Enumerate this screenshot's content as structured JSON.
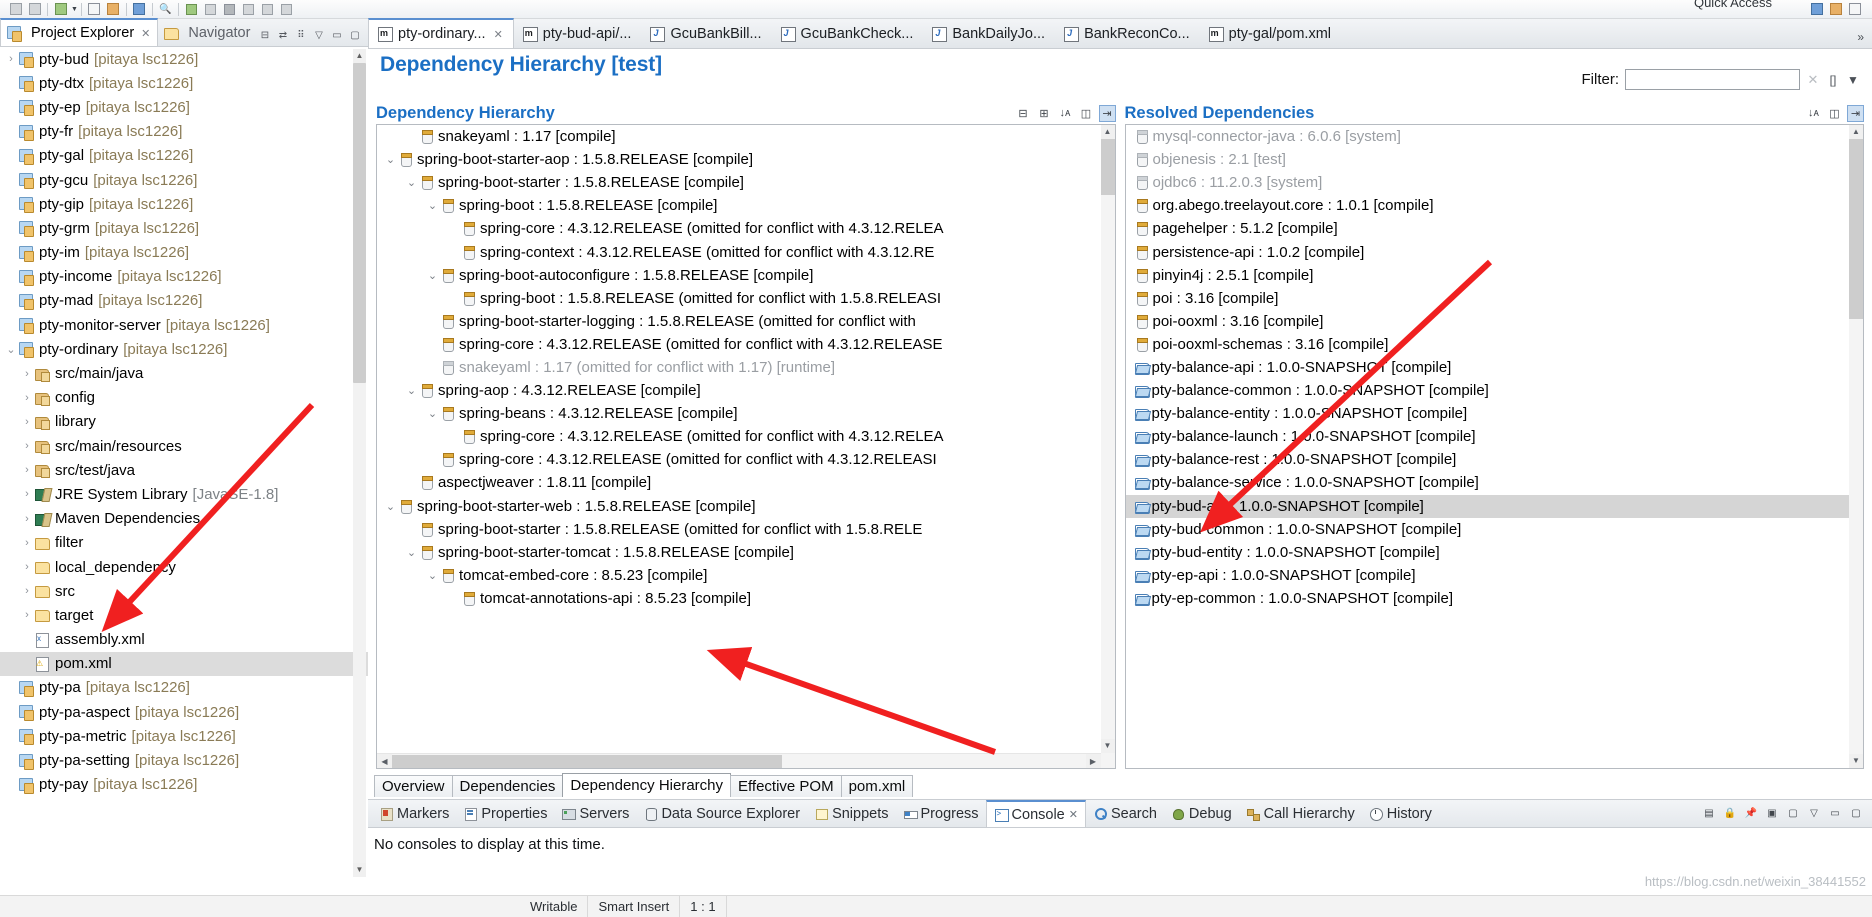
{
  "window": {
    "quick_access": "Quick Access"
  },
  "toolbar": {
    "icons": [
      "save-icon",
      "save-all-icon",
      "export-icon",
      "run-icon",
      "debug-icon",
      "terminal-icon",
      "search-icon",
      "step-over-icon",
      "pause-icon",
      "stop-icon",
      "profile-icon",
      "perspective-icon"
    ]
  },
  "project_explorer": {
    "tabs": [
      {
        "label": "Project Explorer",
        "icon": "project-explorer-icon",
        "active": true,
        "closable": true
      },
      {
        "label": "Navigator",
        "icon": "navigator-icon",
        "active": false,
        "closable": false
      }
    ],
    "toolbar_icons": [
      "collapse-all-icon",
      "link-with-editor-icon",
      "view-menu-icon",
      "minimize-icon",
      "maximize-icon"
    ],
    "tree": [
      {
        "indent": 0,
        "twisty": ">",
        "icon": "maven-project-icon",
        "label": "pty-bud",
        "suffix": "[pitaya lsc1226]",
        "selected": false
      },
      {
        "indent": 0,
        "twisty": "",
        "icon": "maven-project-icon",
        "label": "pty-dtx",
        "suffix": "[pitaya lsc1226]",
        "selected": false
      },
      {
        "indent": 0,
        "twisty": "",
        "icon": "maven-project-icon",
        "label": "pty-ep",
        "suffix": "[pitaya lsc1226]",
        "selected": false
      },
      {
        "indent": 0,
        "twisty": "",
        "icon": "maven-project-icon",
        "label": "pty-fr",
        "suffix": "[pitaya lsc1226]",
        "selected": false
      },
      {
        "indent": 0,
        "twisty": "",
        "icon": "maven-project-icon",
        "label": "pty-gal",
        "suffix": "[pitaya lsc1226]",
        "selected": false
      },
      {
        "indent": 0,
        "twisty": "",
        "icon": "maven-project-icon",
        "label": "pty-gcu",
        "suffix": "[pitaya lsc1226]",
        "selected": false
      },
      {
        "indent": 0,
        "twisty": "",
        "icon": "maven-project-icon",
        "label": "pty-gip",
        "suffix": "[pitaya lsc1226]",
        "selected": false
      },
      {
        "indent": 0,
        "twisty": "",
        "icon": "maven-project-icon",
        "label": "pty-grm",
        "suffix": "[pitaya lsc1226]",
        "selected": false
      },
      {
        "indent": 0,
        "twisty": "",
        "icon": "maven-project-icon",
        "label": "pty-im",
        "suffix": "[pitaya lsc1226]",
        "selected": false
      },
      {
        "indent": 0,
        "twisty": "",
        "icon": "maven-project-icon",
        "label": "pty-income",
        "suffix": "[pitaya lsc1226]",
        "selected": false
      },
      {
        "indent": 0,
        "twisty": "",
        "icon": "maven-project-icon",
        "label": "pty-mad",
        "suffix": "[pitaya lsc1226]",
        "selected": false
      },
      {
        "indent": 0,
        "twisty": "",
        "icon": "maven-project-icon",
        "label": "pty-monitor-server",
        "suffix": "[pitaya lsc1226]",
        "selected": false
      },
      {
        "indent": 0,
        "twisty": "v",
        "icon": "maven-project-icon",
        "label": "pty-ordinary",
        "suffix": "[pitaya lsc1226]",
        "selected": false
      },
      {
        "indent": 1,
        "twisty": ">",
        "icon": "source-folder-icon",
        "label": "src/main/java",
        "suffix": "",
        "selected": false
      },
      {
        "indent": 1,
        "twisty": ">",
        "icon": "source-folder-icon",
        "label": "config",
        "suffix": "",
        "selected": false
      },
      {
        "indent": 1,
        "twisty": ">",
        "icon": "source-folder-icon",
        "label": "library",
        "suffix": "",
        "selected": false
      },
      {
        "indent": 1,
        "twisty": ">",
        "icon": "source-folder-icon",
        "label": "src/main/resources",
        "suffix": "",
        "selected": false
      },
      {
        "indent": 1,
        "twisty": ">",
        "icon": "source-folder-icon",
        "label": "src/test/java",
        "suffix": "",
        "selected": false
      },
      {
        "indent": 1,
        "twisty": ">",
        "icon": "library-icon",
        "label": "JRE System Library",
        "suffix": "[JavaSE-1.8]",
        "selected": false
      },
      {
        "indent": 1,
        "twisty": ">",
        "icon": "library-icon",
        "label": "Maven Dependencies",
        "suffix": "",
        "selected": false
      },
      {
        "indent": 1,
        "twisty": ">",
        "icon": "folder-icon",
        "label": "filter",
        "suffix": "",
        "selected": false
      },
      {
        "indent": 1,
        "twisty": ">",
        "icon": "folder-icon",
        "label": "local_dependency",
        "suffix": "",
        "selected": false
      },
      {
        "indent": 1,
        "twisty": ">",
        "icon": "folder-icon",
        "label": "src",
        "suffix": "",
        "selected": false
      },
      {
        "indent": 1,
        "twisty": ">",
        "icon": "folder-icon",
        "label": "target",
        "suffix": "",
        "selected": false
      },
      {
        "indent": 1,
        "twisty": "",
        "icon": "xml-file-icon",
        "label": "assembly.xml",
        "suffix": "",
        "selected": false
      },
      {
        "indent": 1,
        "twisty": "",
        "icon": "xml-warning-file-icon",
        "label": "pom.xml",
        "suffix": "",
        "selected": true
      },
      {
        "indent": 0,
        "twisty": "",
        "icon": "maven-project-icon",
        "label": "pty-pa",
        "suffix": "[pitaya lsc1226]",
        "selected": false
      },
      {
        "indent": 0,
        "twisty": "",
        "icon": "maven-project-icon",
        "label": "pty-pa-aspect",
        "suffix": "[pitaya lsc1226]",
        "selected": false
      },
      {
        "indent": 0,
        "twisty": "",
        "icon": "maven-project-icon",
        "label": "pty-pa-metric",
        "suffix": "[pitaya lsc1226]",
        "selected": false
      },
      {
        "indent": 0,
        "twisty": "",
        "icon": "maven-project-icon",
        "label": "pty-pa-setting",
        "suffix": "[pitaya lsc1226]",
        "selected": false
      },
      {
        "indent": 0,
        "twisty": "",
        "icon": "maven-project-icon",
        "label": "pty-pay",
        "suffix": "[pitaya lsc1226]",
        "selected": false
      }
    ]
  },
  "editor": {
    "tabs": [
      {
        "label": "pty-ordinary...",
        "icon": "maven-pom-icon",
        "active": true,
        "closable": true
      },
      {
        "label": "pty-bud-api/...",
        "icon": "maven-pom-icon",
        "active": false,
        "closable": false
      },
      {
        "label": "GcuBankBill...",
        "icon": "java-file-icon",
        "active": false,
        "closable": false
      },
      {
        "label": "GcuBankCheck...",
        "icon": "java-file-icon",
        "active": false,
        "closable": false
      },
      {
        "label": "BankDailyJo...",
        "icon": "java-file-icon",
        "active": false,
        "closable": false
      },
      {
        "label": "BankReconCo...",
        "icon": "java-file-icon",
        "active": false,
        "closable": false
      },
      {
        "label": "pty-gal/pom.xml",
        "icon": "maven-pom-icon",
        "active": false,
        "closable": false
      }
    ],
    "overflow_label": "»",
    "title": "Dependency Hierarchy [test]",
    "filter": {
      "label": "Filter:",
      "value": "",
      "placeholder": "",
      "clear_icon": "clear-filter-icon",
      "expand_icon": "expand-icon",
      "menu_icon": "filter-menu-icon"
    },
    "form_tabs": [
      {
        "label": "Overview",
        "active": false
      },
      {
        "label": "Dependencies",
        "active": false
      },
      {
        "label": "Dependency Hierarchy",
        "active": true
      },
      {
        "label": "Effective POM",
        "active": false
      },
      {
        "label": "pom.xml",
        "active": false
      }
    ]
  },
  "hierarchy_pane": {
    "title": "Dependency Hierarchy",
    "tools": [
      "collapse-all-icon",
      "expand-all-icon",
      "sort-alphabetically-icon",
      "show-groupid-icon",
      "link-selection-icon"
    ],
    "rows": [
      {
        "indent": 1,
        "twisty": "",
        "label": "snakeyaml : 1.17 [compile]",
        "dim": false,
        "selected": false
      },
      {
        "indent": 0,
        "twisty": "v",
        "label": "spring-boot-starter-aop : 1.5.8.RELEASE [compile]",
        "dim": false,
        "selected": false
      },
      {
        "indent": 1,
        "twisty": "v",
        "label": "spring-boot-starter : 1.5.8.RELEASE [compile]",
        "dim": false,
        "selected": false
      },
      {
        "indent": 2,
        "twisty": "v",
        "label": "spring-boot : 1.5.8.RELEASE [compile]",
        "dim": false,
        "selected": false
      },
      {
        "indent": 3,
        "twisty": "",
        "label": "spring-core : 4.3.12.RELEASE (omitted for conflict with 4.3.12.RELEA",
        "dim": false,
        "selected": false
      },
      {
        "indent": 3,
        "twisty": "",
        "label": "spring-context : 4.3.12.RELEASE (omitted for conflict with 4.3.12.RE",
        "dim": false,
        "selected": false
      },
      {
        "indent": 2,
        "twisty": "v",
        "label": "spring-boot-autoconfigure : 1.5.8.RELEASE [compile]",
        "dim": false,
        "selected": false
      },
      {
        "indent": 3,
        "twisty": "",
        "label": "spring-boot : 1.5.8.RELEASE (omitted for conflict with 1.5.8.RELEASI",
        "dim": false,
        "selected": false
      },
      {
        "indent": 2,
        "twisty": "",
        "label": "spring-boot-starter-logging : 1.5.8.RELEASE (omitted for conflict with",
        "dim": false,
        "selected": false
      },
      {
        "indent": 2,
        "twisty": "",
        "label": "spring-core : 4.3.12.RELEASE (omitted for conflict with 4.3.12.RELEASE",
        "dim": false,
        "selected": false
      },
      {
        "indent": 2,
        "twisty": "",
        "label": "snakeyaml : 1.17 (omitted for conflict with 1.17) [runtime]",
        "dim": true,
        "selected": false
      },
      {
        "indent": 1,
        "twisty": "v",
        "label": "spring-aop : 4.3.12.RELEASE [compile]",
        "dim": false,
        "selected": false
      },
      {
        "indent": 2,
        "twisty": "v",
        "label": "spring-beans : 4.3.12.RELEASE [compile]",
        "dim": false,
        "selected": false
      },
      {
        "indent": 3,
        "twisty": "",
        "label": "spring-core : 4.3.12.RELEASE (omitted for conflict with 4.3.12.RELEA",
        "dim": false,
        "selected": false
      },
      {
        "indent": 2,
        "twisty": "",
        "label": "spring-core : 4.3.12.RELEASE (omitted for conflict with 4.3.12.RELEASI",
        "dim": false,
        "selected": false
      },
      {
        "indent": 1,
        "twisty": "",
        "label": "aspectjweaver : 1.8.11 [compile]",
        "dim": false,
        "selected": false
      },
      {
        "indent": 0,
        "twisty": "v",
        "label": "spring-boot-starter-web : 1.5.8.RELEASE [compile]",
        "dim": false,
        "selected": false
      },
      {
        "indent": 1,
        "twisty": "",
        "label": "spring-boot-starter : 1.5.8.RELEASE (omitted for conflict with 1.5.8.RELE",
        "dim": false,
        "selected": false
      },
      {
        "indent": 1,
        "twisty": "v",
        "label": "spring-boot-starter-tomcat : 1.5.8.RELEASE [compile]",
        "dim": false,
        "selected": false
      },
      {
        "indent": 2,
        "twisty": "v",
        "label": "tomcat-embed-core : 8.5.23 [compile]",
        "dim": false,
        "selected": false
      },
      {
        "indent": 3,
        "twisty": "",
        "label": "tomcat-annotations-api : 8.5.23 [compile]",
        "dim": false,
        "selected": false
      }
    ]
  },
  "resolved_pane": {
    "title": "Resolved Dependencies",
    "tools": [
      "sort-icon",
      "show-groupid-icon",
      "link-selection-icon"
    ],
    "rows": [
      {
        "icon": "jar-icon",
        "label": "mysql-connector-java : 6.0.6 [system]",
        "dim": true,
        "selected": false
      },
      {
        "icon": "jar-icon",
        "label": "objenesis : 2.1 [test]",
        "dim": true,
        "selected": false
      },
      {
        "icon": "jar-icon",
        "label": "ojdbc6 : 11.2.0.3 [system]",
        "dim": true,
        "selected": false
      },
      {
        "icon": "jar-icon",
        "label": "org.abego.treelayout.core : 1.0.1 [compile]",
        "dim": false,
        "selected": false
      },
      {
        "icon": "jar-icon",
        "label": "pagehelper : 5.1.2 [compile]",
        "dim": false,
        "selected": false
      },
      {
        "icon": "jar-icon",
        "label": "persistence-api : 1.0.2 [compile]",
        "dim": false,
        "selected": false
      },
      {
        "icon": "jar-icon",
        "label": "pinyin4j : 2.5.1 [compile]",
        "dim": false,
        "selected": false
      },
      {
        "icon": "jar-icon",
        "label": "poi : 3.16 [compile]",
        "dim": false,
        "selected": false
      },
      {
        "icon": "jar-icon",
        "label": "poi-ooxml : 3.16 [compile]",
        "dim": false,
        "selected": false
      },
      {
        "icon": "jar-icon",
        "label": "poi-ooxml-schemas : 3.16 [compile]",
        "dim": false,
        "selected": false
      },
      {
        "icon": "project-folder-icon",
        "label": "pty-balance-api : 1.0.0-SNAPSHOT [compile]",
        "dim": false,
        "selected": false
      },
      {
        "icon": "project-folder-icon",
        "label": "pty-balance-common : 1.0.0-SNAPSHOT [compile]",
        "dim": false,
        "selected": false
      },
      {
        "icon": "project-folder-icon",
        "label": "pty-balance-entity : 1.0.0-SNAPSHOT [compile]",
        "dim": false,
        "selected": false
      },
      {
        "icon": "project-folder-icon",
        "label": "pty-balance-launch : 1.0.0-SNAPSHOT [compile]",
        "dim": false,
        "selected": false
      },
      {
        "icon": "project-folder-icon",
        "label": "pty-balance-rest : 1.0.0-SNAPSHOT [compile]",
        "dim": false,
        "selected": false
      },
      {
        "icon": "project-folder-icon",
        "label": "pty-balance-service : 1.0.0-SNAPSHOT [compile]",
        "dim": false,
        "selected": false
      },
      {
        "icon": "project-folder-icon",
        "label": "pty-bud-api : 1.0.0-SNAPSHOT [compile]",
        "dim": false,
        "selected": true
      },
      {
        "icon": "project-folder-icon",
        "label": "pty-bud-common : 1.0.0-SNAPSHOT [compile]",
        "dim": false,
        "selected": false
      },
      {
        "icon": "project-folder-icon",
        "label": "pty-bud-entity : 1.0.0-SNAPSHOT [compile]",
        "dim": false,
        "selected": false
      },
      {
        "icon": "project-folder-icon",
        "label": "pty-ep-api : 1.0.0-SNAPSHOT [compile]",
        "dim": false,
        "selected": false
      },
      {
        "icon": "project-folder-icon",
        "label": "pty-ep-common : 1.0.0-SNAPSHOT [compile]",
        "dim": false,
        "selected": false
      }
    ]
  },
  "bottom_views": {
    "tabs": [
      {
        "label": "Markers",
        "icon": "markers-icon",
        "active": false,
        "closable": false
      },
      {
        "label": "Properties",
        "icon": "properties-icon",
        "active": false,
        "closable": false
      },
      {
        "label": "Servers",
        "icon": "servers-icon",
        "active": false,
        "closable": false
      },
      {
        "label": "Data Source Explorer",
        "icon": "data-source-explorer-icon",
        "active": false,
        "closable": false
      },
      {
        "label": "Snippets",
        "icon": "snippets-icon",
        "active": false,
        "closable": false
      },
      {
        "label": "Progress",
        "icon": "progress-icon",
        "active": false,
        "closable": false
      },
      {
        "label": "Console",
        "icon": "console-icon",
        "active": true,
        "closable": true
      },
      {
        "label": "Search",
        "icon": "search-icon",
        "active": false,
        "closable": false
      },
      {
        "label": "Debug",
        "icon": "debug-icon",
        "active": false,
        "closable": false
      },
      {
        "label": "Call Hierarchy",
        "icon": "call-hierarchy-icon",
        "active": false,
        "closable": false
      },
      {
        "label": "History",
        "icon": "history-icon",
        "active": false,
        "closable": false
      }
    ],
    "tools": [
      "clear-console-icon",
      "scroll-lock-icon",
      "pin-console-icon",
      "display-console-icon",
      "open-console-icon",
      "view-menu-icon",
      "minimize-icon",
      "maximize-icon"
    ],
    "console_message": "No consoles to display at this time."
  },
  "status_bar": {
    "cells": [
      "Writable",
      "Smart Insert",
      "1 : 1"
    ]
  },
  "watermark": "https://blog.csdn.net/weixin_38441552",
  "colors": {
    "accent_blue": "#1b6fc4",
    "selection_gray": "#d5d5d5",
    "annotation_red": "#f02020",
    "dim_text": "#9a9ea3"
  }
}
